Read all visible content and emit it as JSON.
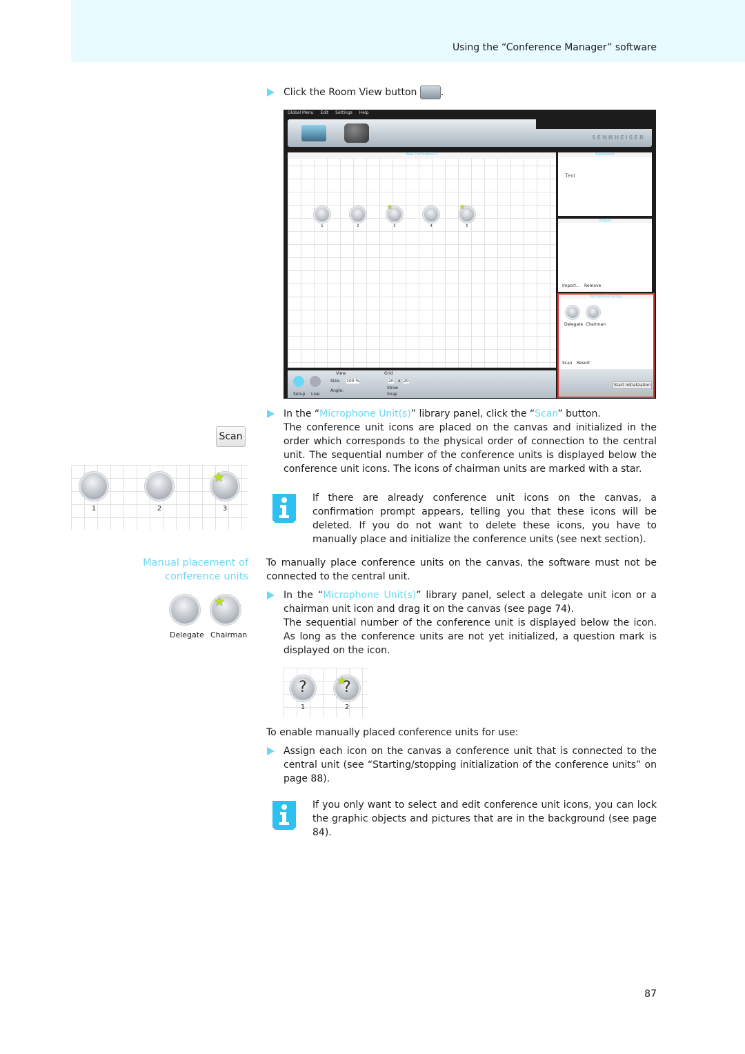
{
  "header": {
    "title": "Using the “Conference Manager” software"
  },
  "step1": {
    "text": "Click the Room View button",
    "icon": "room-view-icon"
  },
  "app": {
    "menu": [
      "Global Menu",
      "Edit",
      "Settings",
      "Help"
    ],
    "brand": "SENNHEISER",
    "canvas_title": "New Conference 1",
    "units": [
      "1",
      "2",
      "3",
      "4",
      "5"
    ],
    "chairman_units": [
      "3",
      "5"
    ],
    "equipment_title": "Equipment",
    "equipment_text": "Text",
    "images_title": "Images",
    "import_label": "Import...",
    "remove_label": "Remove",
    "mic_title": "Microphone Unit(s)",
    "delegate": "Delegate",
    "chairman": "Chairman",
    "scan": "Scan",
    "resort": "Resort",
    "setup": "Setup",
    "live": "Live",
    "view_label": "View",
    "size_label": "Size:",
    "size_value": "100 %",
    "angle_label": "Angle:",
    "grid_label": "Grid",
    "grid_x": "20",
    "grid_x_sep": "x",
    "grid_y": "20",
    "show": "Show",
    "snap": "Snap",
    "start_init": "Start Initialization",
    "highlight_color": "#e53030"
  },
  "para1": {
    "pre": "In the “",
    "link1": "Microphone Unit(s)",
    "mid": "” library panel, click the “",
    "link2": "Scan",
    "post": "” button.",
    "body": "The conference unit icons are placed on the canvas and initialized in the order which corresponds to the physical order of connection to the central unit. The sequential number of the conference units is displayed below the conference unit icons. The icons of chairman units are marked with a star."
  },
  "side_scan": "Scan",
  "side_units": [
    "1",
    "2",
    "3"
  ],
  "note1": "If there are already conference unit icons on the canvas, a confirmation prompt appears, telling you that these icons will be deleted. If you do not want to delete these icons, you have to manually place and initialize the conference units (see next section).",
  "section": {
    "title_line1": "Manual placement of",
    "title_line2": "conference units",
    "intro": "To manually place conference units on the canvas, the software must not be connected to the central unit."
  },
  "side_icons": {
    "delegate": "Delegate",
    "chairman": "Chairman"
  },
  "para2": {
    "pre": "In the “",
    "link": "Microphone Unit(s)",
    "post": "” library panel, select a delegate unit icon or a chairman unit icon and drag it on the canvas (see page 74).",
    "body": "The sequential number of the conference unit is displayed below the icon. As long as the conference units are not yet initialized, a question mark is displayed on the icon."
  },
  "q_units": [
    "1",
    "2"
  ],
  "q_mark": "?",
  "enable": "To enable manually placed conference units for use:",
  "para3": "Assign each icon on the canvas a conference unit that is connected to the central unit (see “Starting/stopping initialization of the conference units” on page 88).",
  "note2": "If you only want to select and edit conference unit icons, you can lock the graphic objects and pictures that are in the background (see page 84).",
  "page_number": "87",
  "colors": {
    "accent": "#6ad8f5",
    "header_bg": "#e8fbfe"
  }
}
